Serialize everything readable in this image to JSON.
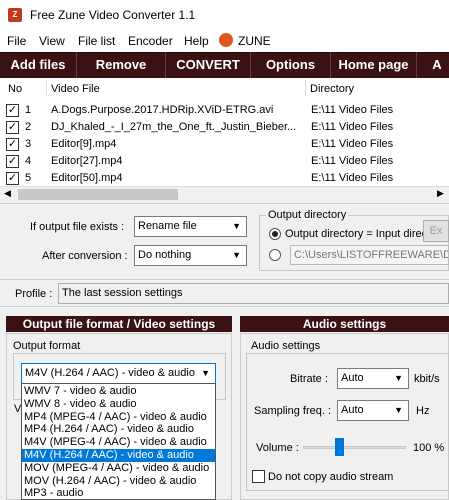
{
  "window": {
    "title": "Free Zune Video Converter 1.1",
    "icon": "app-icon"
  },
  "menu": {
    "items": [
      "File",
      "View",
      "File list",
      "Encoder",
      "Help"
    ],
    "zune_label": "ZUNE"
  },
  "toolbar": {
    "buttons": [
      "Add files",
      "Remove",
      "CONVERT",
      "Options",
      "Home page",
      "A"
    ]
  },
  "filelist": {
    "columns": [
      "No",
      "Video File",
      "Directory"
    ],
    "rows": [
      {
        "no": "1",
        "file": "A.Dogs.Purpose.2017.HDRip.XViD-ETRG.avi",
        "dir": "E:\\11 Video Files",
        "checked": true
      },
      {
        "no": "2",
        "file": "DJ_Khaled_-_I_27m_the_One_ft._Justin_Bieber...",
        "dir": "E:\\11 Video Files",
        "checked": true
      },
      {
        "no": "3",
        "file": "Editor[9].mp4",
        "dir": "E:\\11 Video Files",
        "checked": true
      },
      {
        "no": "4",
        "file": "Editor[27].mp4",
        "dir": "E:\\11 Video Files",
        "checked": true
      },
      {
        "no": "5",
        "file": "Editor[50].mp4",
        "dir": "E:\\11 Video Files",
        "checked": true
      }
    ]
  },
  "options": {
    "if_exists_label": "If output file exists :",
    "if_exists_value": "Rename file",
    "after_label": "After conversion :",
    "after_value": "Do nothing",
    "output_dir_title": "Output directory",
    "radio_input_dir": "Output directory = Input direc",
    "browse_label": "Ex",
    "path_value": "C:\\Users\\LISTOFFREEWARE\\Do"
  },
  "profile": {
    "label": "Profile :",
    "value": "The last session settings"
  },
  "video_section": {
    "title": "Output file format / Video settings",
    "output_format_label": "Output format",
    "selected": "M4V (H.264 / AAC) - video & audio",
    "options": [
      "WMV 7 - video & audio",
      "WMV 8 - video & audio",
      "MP4 (MPEG-4 / AAC) - video & audio",
      "MP4 (H.264 / AAC) - video & audio",
      "M4V (MPEG-4 / AAC) - video & audio",
      "M4V (H.264 / AAC) - video & audio",
      "MOV (MPEG-4 / AAC) - video & audio",
      "MOV (H.264 / AAC) - video & audio",
      "MP3 - audio"
    ],
    "selected_index": 5,
    "v_letter": "V"
  },
  "audio_section": {
    "title": "Audio settings",
    "group_label": "Audio settings",
    "bitrate_label": "Bitrate :",
    "bitrate_value": "Auto",
    "bitrate_unit": "kbit/s",
    "sampling_label": "Sampling freq. :",
    "sampling_value": "Auto",
    "sampling_unit": "Hz",
    "volume_label": "Volume :",
    "volume_value": "100 %",
    "volume_level": 0.35,
    "no_copy_label": "Do not copy audio stream"
  }
}
